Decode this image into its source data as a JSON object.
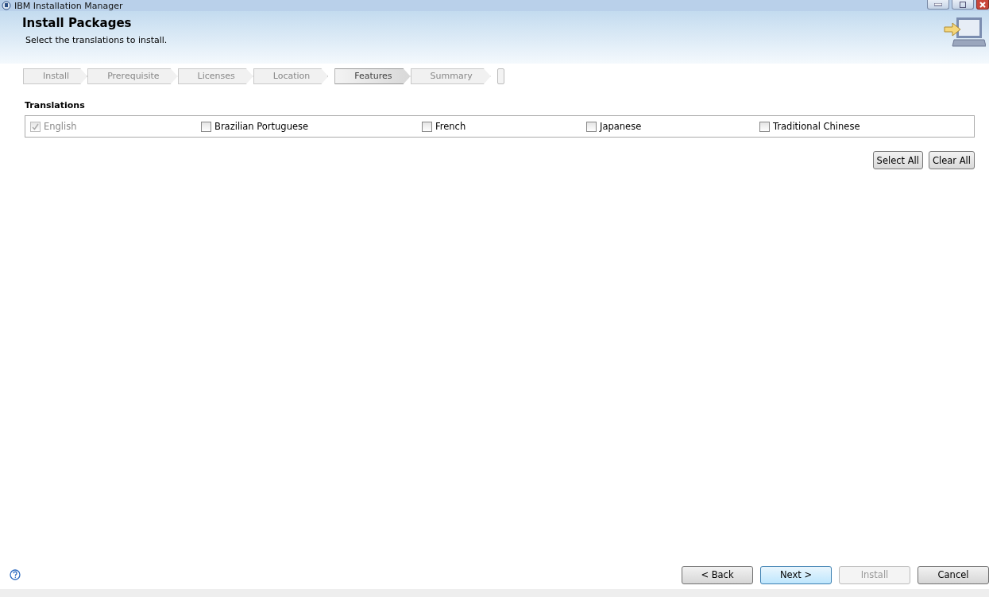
{
  "window": {
    "title": "IBM Installation Manager"
  },
  "header": {
    "title": "Install Packages",
    "subtitle": "Select the translations to install."
  },
  "step_groups": [
    [
      {
        "label": "Install",
        "selected": false
      },
      {
        "label": "Prerequisite",
        "selected": false
      },
      {
        "label": "Licenses",
        "selected": false
      },
      {
        "label": "Location",
        "selected": false
      }
    ],
    [
      {
        "label": "Features",
        "selected": true
      },
      {
        "label": "Summary",
        "selected": false
      }
    ]
  ],
  "translations": {
    "title": "Translations",
    "items": [
      {
        "label": "English",
        "checked": true,
        "disabled": true
      },
      {
        "label": "Brazilian Portuguese",
        "checked": false,
        "disabled": false
      },
      {
        "label": "French",
        "checked": false,
        "disabled": false
      },
      {
        "label": "Japanese",
        "checked": false,
        "disabled": false
      },
      {
        "label": "Traditional Chinese",
        "checked": false,
        "disabled": false
      }
    ]
  },
  "list_buttons": [
    "Select All",
    "Clear All"
  ],
  "footer_buttons": [
    {
      "label": "< Back",
      "default": false,
      "disabled": false
    },
    {
      "label": "Next >",
      "default": true,
      "disabled": false
    },
    {
      "label": "Install",
      "default": false,
      "disabled": true
    },
    {
      "label": "Cancel",
      "default": false,
      "disabled": false
    }
  ]
}
